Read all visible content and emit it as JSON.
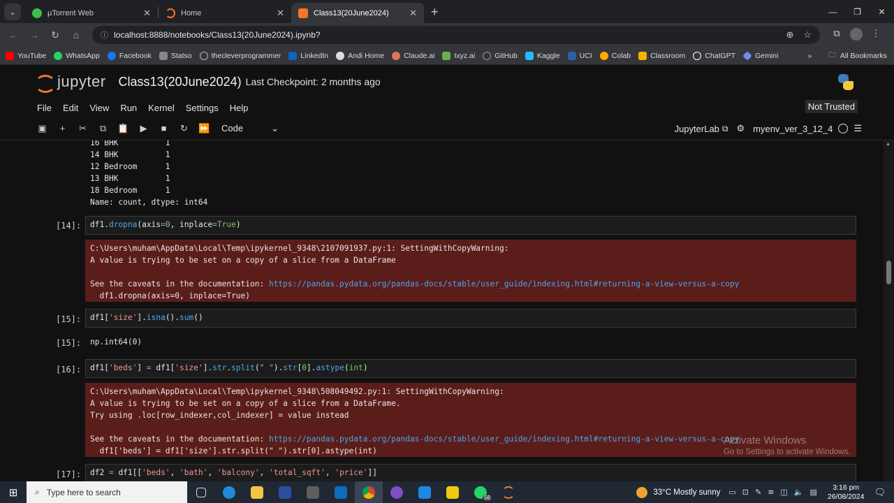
{
  "browser": {
    "tabs": [
      {
        "title": "µTorrent Web",
        "favicon_color": "#3bbf4a",
        "active": false
      },
      {
        "title": "Home",
        "favicon_color": "#f37726",
        "active": false
      },
      {
        "title": "Class13(20June2024)",
        "favicon_color": "#f37726",
        "active": true
      }
    ],
    "url": "localhost:8888/notebooks/Class13(20June2024).ipynb?",
    "bookmarks": [
      {
        "label": "YouTube",
        "color": "#ff0000"
      },
      {
        "label": "WhatsApp",
        "color": "#25d366"
      },
      {
        "label": "Facebook",
        "color": "#1877f2"
      },
      {
        "label": "Statso",
        "color": "#888888"
      },
      {
        "label": "thecleverprogrammer",
        "color": "#bbbbbb"
      },
      {
        "label": "LinkedIn",
        "color": "#0a66c2"
      },
      {
        "label": "Andi Home",
        "color": "#dddddd"
      },
      {
        "label": "Claude.ai",
        "color": "#d97757"
      },
      {
        "label": "txyz.ai",
        "color": "#6ab04c"
      },
      {
        "label": "GitHub",
        "color": "#333333"
      },
      {
        "label": "Kaggle",
        "color": "#20beff"
      },
      {
        "label": "UCI",
        "color": "#2f5fa5"
      },
      {
        "label": "Colab",
        "color": "#f9ab00"
      },
      {
        "label": "Classroom",
        "color": "#f4b400"
      },
      {
        "label": "ChatGPT",
        "color": "#ffffff"
      },
      {
        "label": "Gemini",
        "color": "#6d8cf5"
      }
    ],
    "all_bookmarks": "All Bookmarks"
  },
  "jupyter": {
    "logo_text": "jupyter",
    "notebook_title": "Class13(20June2024)",
    "checkpoint": "Last Checkpoint: 2 months ago",
    "menu": [
      "File",
      "Edit",
      "View",
      "Run",
      "Kernel",
      "Settings",
      "Help"
    ],
    "trust": "Not Trusted",
    "cell_type": "Code",
    "jupyterlab_label": "JupyterLab",
    "kernel_name": "myenv_ver_3_12_4"
  },
  "cells": {
    "out13_lines": [
      "16 BHK          1",
      "14 BHK          1",
      "12 Bedroom      1",
      "13 BHK          1",
      "18 Bedroom      1",
      "Name: count, dtype: int64"
    ],
    "c14_prompt": "[14]:",
    "c14_warn": [
      "C:\\Users\\muham\\AppData\\Local\\Temp\\ipykernel_9348\\2107091937.py:1: SettingWithCopyWarning:",
      "A value is trying to be set on a copy of a slice from a DataFrame",
      "",
      "See the caveats in the documentation: ",
      "  df1.dropna(axis=0, inplace=True)"
    ],
    "doc_link": "https://pandas.pydata.org/pandas-docs/stable/user_guide/indexing.html#returning-a-view-versus-a-copy",
    "c15_prompt": "[15]:",
    "c15_out_prompt": "[15]:",
    "c15_out": "np.int64(0)",
    "c16_prompt": "[16]:",
    "c16_warn": [
      "C:\\Users\\muham\\AppData\\Local\\Temp\\ipykernel_9348\\508049492.py:1: SettingWithCopyWarning:",
      "A value is trying to be set on a copy of a slice from a DataFrame.",
      "Try using .loc[row_indexer,col_indexer] = value instead",
      "",
      "See the caveats in the documentation: ",
      "  df1['beds'] = df1['size'].str.split(\" \").str[0].astype(int)"
    ],
    "c17_prompt": "[17]:"
  },
  "watermark": {
    "line1": "Activate Windows",
    "line2": "Go to Settings to activate Windows."
  },
  "taskbar": {
    "search_placeholder": "Type here to search",
    "weather": "33°C  Mostly sunny",
    "time": "3:16 pm",
    "date": "26/08/2024",
    "badge": "56"
  }
}
